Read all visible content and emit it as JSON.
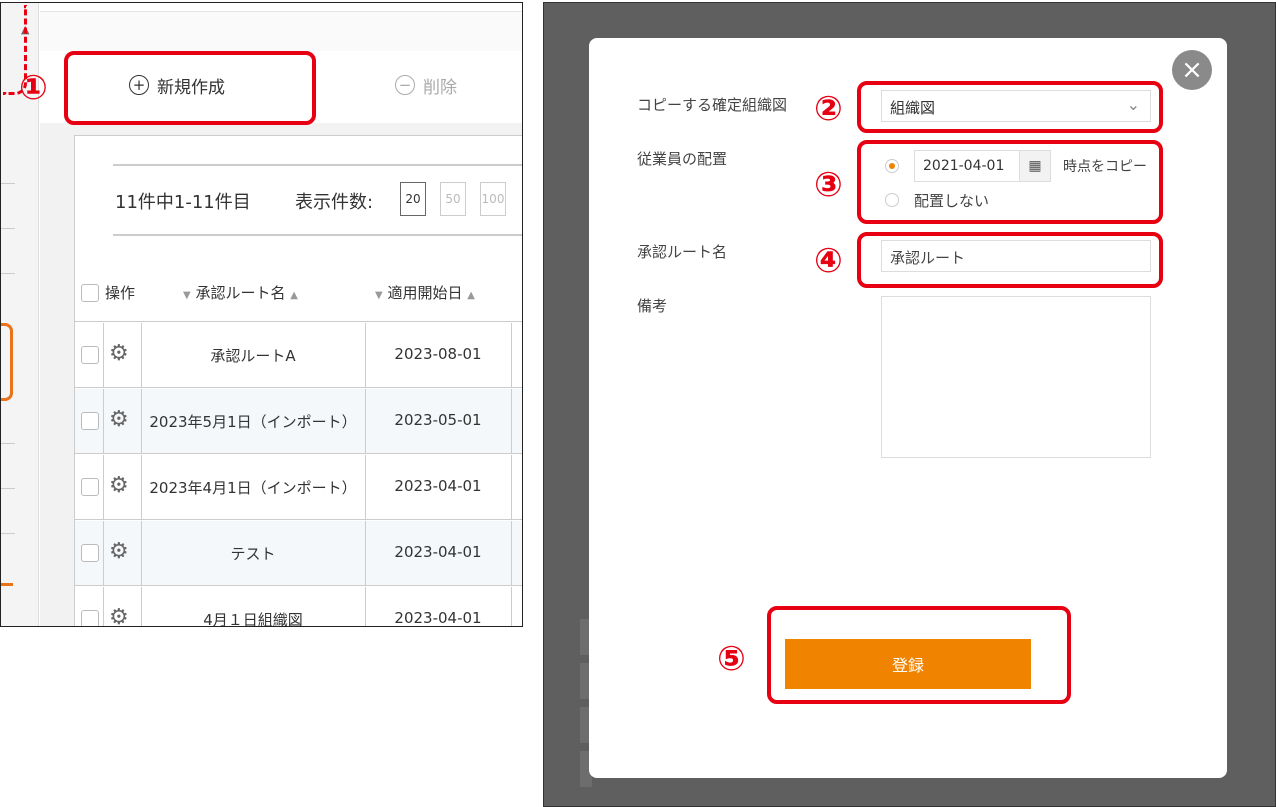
{
  "list_screen": {
    "toolbar": {
      "new_label": "新規作成",
      "delete_label": "削除"
    },
    "pager": {
      "count_text": "11件中1-11件目",
      "per_page_label": "表示件数:",
      "per_page_options": [
        "20",
        "50",
        "100"
      ]
    },
    "table": {
      "headers": {
        "ops": "操作",
        "route_name": "承認ルート名",
        "start_date": "適用開始日"
      },
      "rows": [
        {
          "name": "承認ルートA",
          "date": "2023-08-01"
        },
        {
          "name": "2023年5月1日（インポート）",
          "date": "2023-05-01"
        },
        {
          "name": "2023年4月1日（インポート）",
          "date": "2023-04-01"
        },
        {
          "name": "テスト",
          "date": "2023-04-01"
        },
        {
          "name": "4月１日組織図",
          "date": "2023-04-01"
        }
      ]
    }
  },
  "modal": {
    "copy_org_label": "コピーする確定組織図",
    "copy_org_value": "組織図",
    "placement_label": "従業員の配置",
    "placement_date": "2021-04-01",
    "placement_copy_text": "時点をコピー",
    "placement_none_text": "配置しない",
    "route_name_label": "承認ルート名",
    "route_name_value": "承認ルート",
    "notes_label": "備考",
    "register_label": "登録"
  },
  "annotations": [
    "①",
    "②",
    "③",
    "④",
    "⑤"
  ],
  "colors": {
    "highlight": "#e60012",
    "primary": "#f08300",
    "overlay": "#5f5f5f"
  }
}
